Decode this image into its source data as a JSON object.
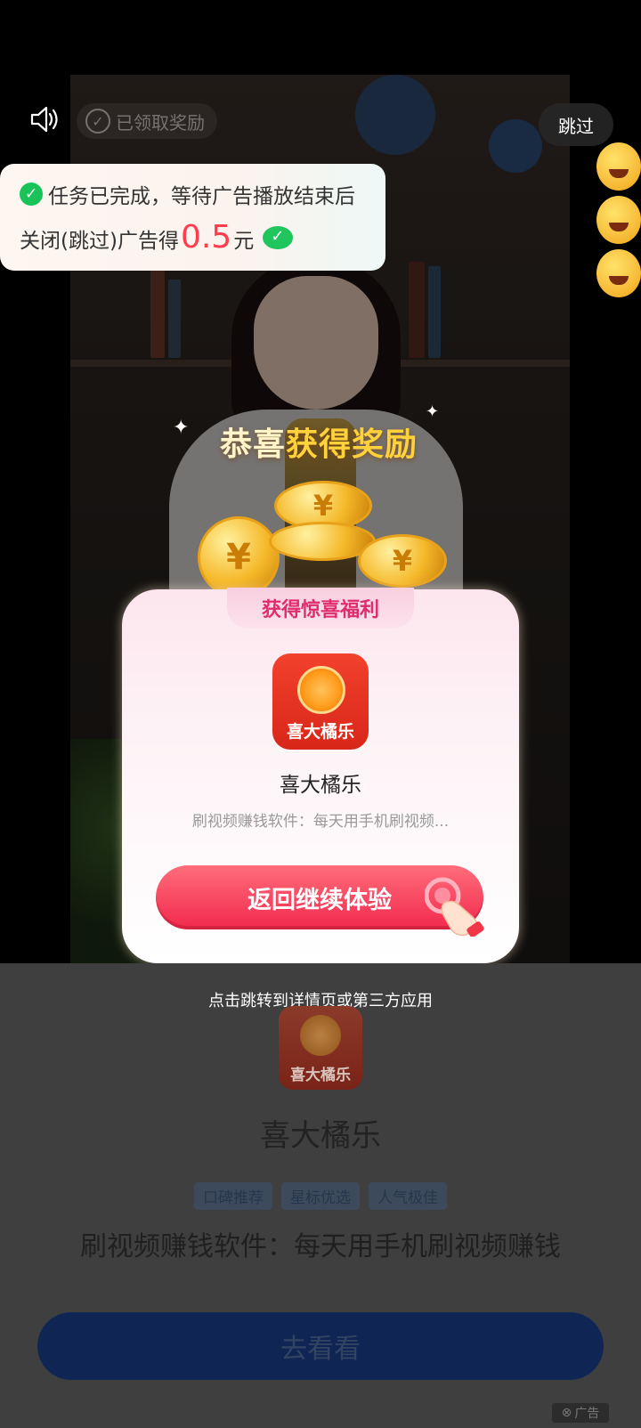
{
  "top": {
    "received_label": "已领取奖励",
    "skip_label": "跳过"
  },
  "task": {
    "line1": "任务已完成，等待广告播放结束后",
    "line2_prefix": "关闭(跳过)广告得",
    "amount": "0.5",
    "unit": "元"
  },
  "reward": {
    "title_prefix": "恭喜",
    "title_highlight": "获得奖励",
    "coin_symbol": "¥",
    "card_tab": "获得惊喜福利",
    "app_icon_label": "喜大橘乐",
    "app_name": "喜大橘乐",
    "app_desc": "刷视频赚钱软件：每天用手机刷视频...",
    "return_button": "返回继续体验"
  },
  "bottom": {
    "hint": "点击跳转到详情页或第三方应用",
    "icon_label": "喜大橘乐",
    "app_name": "喜大橘乐",
    "tags": [
      "口碑推荐",
      "星标优选",
      "人气极佳"
    ],
    "description": "刷视频赚钱软件：每天用手机刷视频赚钱",
    "go_button": "去看看",
    "ad_label": "广告"
  }
}
